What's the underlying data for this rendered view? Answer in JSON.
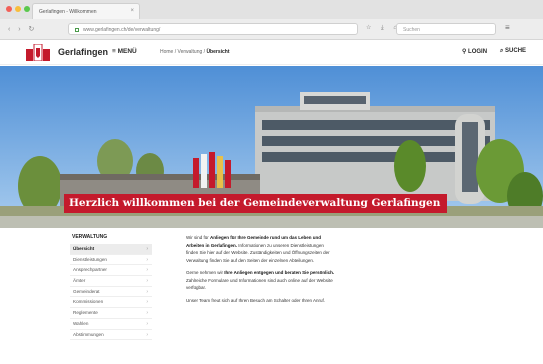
{
  "browser": {
    "tab_title": "Gerlafingen - Willkommen",
    "tab_close": "×",
    "nav_buttons": "‹ › ↻",
    "url": "www.gerlafingen.ch/de/verwaltung/",
    "toolbar_icons": "☆ ⤓ ⌂",
    "search_placeholder": "Suchen",
    "menu_icon": "≡"
  },
  "header": {
    "brand": "Gerlafingen",
    "menu_label": "≡ MENÜ",
    "breadcrumb": {
      "home": "Home",
      "sep1": " / ",
      "section": "Verwaltung",
      "sep2": " / ",
      "current": "Übersicht"
    },
    "login_label": "⚲ LOGIN",
    "search_label": "⌕ SUCHE"
  },
  "hero": {
    "welcome_text": "Herzlich willkommen bei der Gemeindeverwaltung Gerlafingen"
  },
  "sidebar": {
    "heading": "VERWALTUNG",
    "items": [
      {
        "label": "Übersicht",
        "active": true
      },
      {
        "label": "Dienstleistungen",
        "active": false
      },
      {
        "label": "Ansprechpartner",
        "active": false
      },
      {
        "label": "Ämter",
        "active": false
      },
      {
        "label": "Gemeinderat",
        "active": false
      },
      {
        "label": "Kommissionen",
        "active": false
      },
      {
        "label": "Reglemente",
        "active": false
      },
      {
        "label": "Wahlen",
        "active": false
      },
      {
        "label": "Abstimmungen",
        "active": false
      }
    ],
    "chevron": "›"
  },
  "body_text": {
    "p1_a": "Wir sind für ",
    "p1_b": "Anliegen für Ihre Gemeinde rund um das Leben und Arbeiten in Gerlafingen.",
    "p1_c": " Informationen zu unseren Dienstleistungen finden Sie hier auf der Website. Zuständigkeiten und Öffnungszeiten der Verwaltung finden Sie auf den Seiten der einzelnen Abteilungen.",
    "p2_a": "Gerne nehmen wir ",
    "p2_b": "Ihre Anliegen entgegen und beraten Sie persönlich.",
    "p2_c": " Zahlreiche Formulare und Informationen sind auch online auf der Website verfügbar.",
    "p3": "Unser Team freut sich auf Ihren Besuch am Schalter oder Ihren Anruf."
  },
  "colors": {
    "accent_red": "#c41a2c"
  }
}
